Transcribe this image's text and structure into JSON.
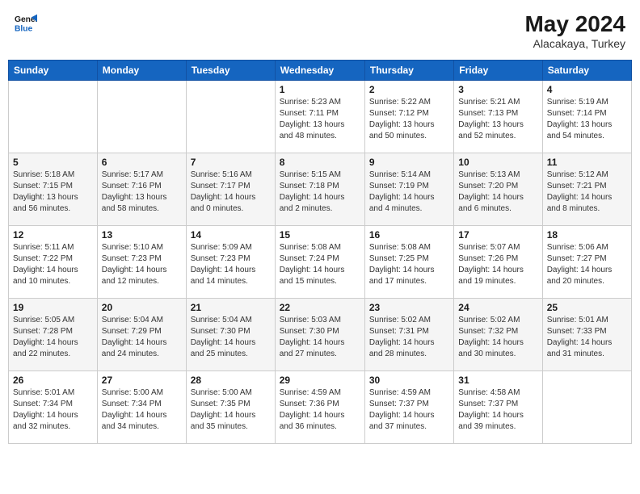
{
  "logo": {
    "line1": "General",
    "line2": "Blue"
  },
  "title": {
    "month": "May 2024",
    "location": "Alacakaya, Turkey"
  },
  "weekdays": [
    "Sunday",
    "Monday",
    "Tuesday",
    "Wednesday",
    "Thursday",
    "Friday",
    "Saturday"
  ],
  "weeks": [
    [
      {
        "day": "",
        "info": ""
      },
      {
        "day": "",
        "info": ""
      },
      {
        "day": "",
        "info": ""
      },
      {
        "day": "1",
        "info": "Sunrise: 5:23 AM\nSunset: 7:11 PM\nDaylight: 13 hours\nand 48 minutes."
      },
      {
        "day": "2",
        "info": "Sunrise: 5:22 AM\nSunset: 7:12 PM\nDaylight: 13 hours\nand 50 minutes."
      },
      {
        "day": "3",
        "info": "Sunrise: 5:21 AM\nSunset: 7:13 PM\nDaylight: 13 hours\nand 52 minutes."
      },
      {
        "day": "4",
        "info": "Sunrise: 5:19 AM\nSunset: 7:14 PM\nDaylight: 13 hours\nand 54 minutes."
      }
    ],
    [
      {
        "day": "5",
        "info": "Sunrise: 5:18 AM\nSunset: 7:15 PM\nDaylight: 13 hours\nand 56 minutes."
      },
      {
        "day": "6",
        "info": "Sunrise: 5:17 AM\nSunset: 7:16 PM\nDaylight: 13 hours\nand 58 minutes."
      },
      {
        "day": "7",
        "info": "Sunrise: 5:16 AM\nSunset: 7:17 PM\nDaylight: 14 hours\nand 0 minutes."
      },
      {
        "day": "8",
        "info": "Sunrise: 5:15 AM\nSunset: 7:18 PM\nDaylight: 14 hours\nand 2 minutes."
      },
      {
        "day": "9",
        "info": "Sunrise: 5:14 AM\nSunset: 7:19 PM\nDaylight: 14 hours\nand 4 minutes."
      },
      {
        "day": "10",
        "info": "Sunrise: 5:13 AM\nSunset: 7:20 PM\nDaylight: 14 hours\nand 6 minutes."
      },
      {
        "day": "11",
        "info": "Sunrise: 5:12 AM\nSunset: 7:21 PM\nDaylight: 14 hours\nand 8 minutes."
      }
    ],
    [
      {
        "day": "12",
        "info": "Sunrise: 5:11 AM\nSunset: 7:22 PM\nDaylight: 14 hours\nand 10 minutes."
      },
      {
        "day": "13",
        "info": "Sunrise: 5:10 AM\nSunset: 7:23 PM\nDaylight: 14 hours\nand 12 minutes."
      },
      {
        "day": "14",
        "info": "Sunrise: 5:09 AM\nSunset: 7:23 PM\nDaylight: 14 hours\nand 14 minutes."
      },
      {
        "day": "15",
        "info": "Sunrise: 5:08 AM\nSunset: 7:24 PM\nDaylight: 14 hours\nand 15 minutes."
      },
      {
        "day": "16",
        "info": "Sunrise: 5:08 AM\nSunset: 7:25 PM\nDaylight: 14 hours\nand 17 minutes."
      },
      {
        "day": "17",
        "info": "Sunrise: 5:07 AM\nSunset: 7:26 PM\nDaylight: 14 hours\nand 19 minutes."
      },
      {
        "day": "18",
        "info": "Sunrise: 5:06 AM\nSunset: 7:27 PM\nDaylight: 14 hours\nand 20 minutes."
      }
    ],
    [
      {
        "day": "19",
        "info": "Sunrise: 5:05 AM\nSunset: 7:28 PM\nDaylight: 14 hours\nand 22 minutes."
      },
      {
        "day": "20",
        "info": "Sunrise: 5:04 AM\nSunset: 7:29 PM\nDaylight: 14 hours\nand 24 minutes."
      },
      {
        "day": "21",
        "info": "Sunrise: 5:04 AM\nSunset: 7:30 PM\nDaylight: 14 hours\nand 25 minutes."
      },
      {
        "day": "22",
        "info": "Sunrise: 5:03 AM\nSunset: 7:30 PM\nDaylight: 14 hours\nand 27 minutes."
      },
      {
        "day": "23",
        "info": "Sunrise: 5:02 AM\nSunset: 7:31 PM\nDaylight: 14 hours\nand 28 minutes."
      },
      {
        "day": "24",
        "info": "Sunrise: 5:02 AM\nSunset: 7:32 PM\nDaylight: 14 hours\nand 30 minutes."
      },
      {
        "day": "25",
        "info": "Sunrise: 5:01 AM\nSunset: 7:33 PM\nDaylight: 14 hours\nand 31 minutes."
      }
    ],
    [
      {
        "day": "26",
        "info": "Sunrise: 5:01 AM\nSunset: 7:34 PM\nDaylight: 14 hours\nand 32 minutes."
      },
      {
        "day": "27",
        "info": "Sunrise: 5:00 AM\nSunset: 7:34 PM\nDaylight: 14 hours\nand 34 minutes."
      },
      {
        "day": "28",
        "info": "Sunrise: 5:00 AM\nSunset: 7:35 PM\nDaylight: 14 hours\nand 35 minutes."
      },
      {
        "day": "29",
        "info": "Sunrise: 4:59 AM\nSunset: 7:36 PM\nDaylight: 14 hours\nand 36 minutes."
      },
      {
        "day": "30",
        "info": "Sunrise: 4:59 AM\nSunset: 7:37 PM\nDaylight: 14 hours\nand 37 minutes."
      },
      {
        "day": "31",
        "info": "Sunrise: 4:58 AM\nSunset: 7:37 PM\nDaylight: 14 hours\nand 39 minutes."
      },
      {
        "day": "",
        "info": ""
      }
    ]
  ]
}
